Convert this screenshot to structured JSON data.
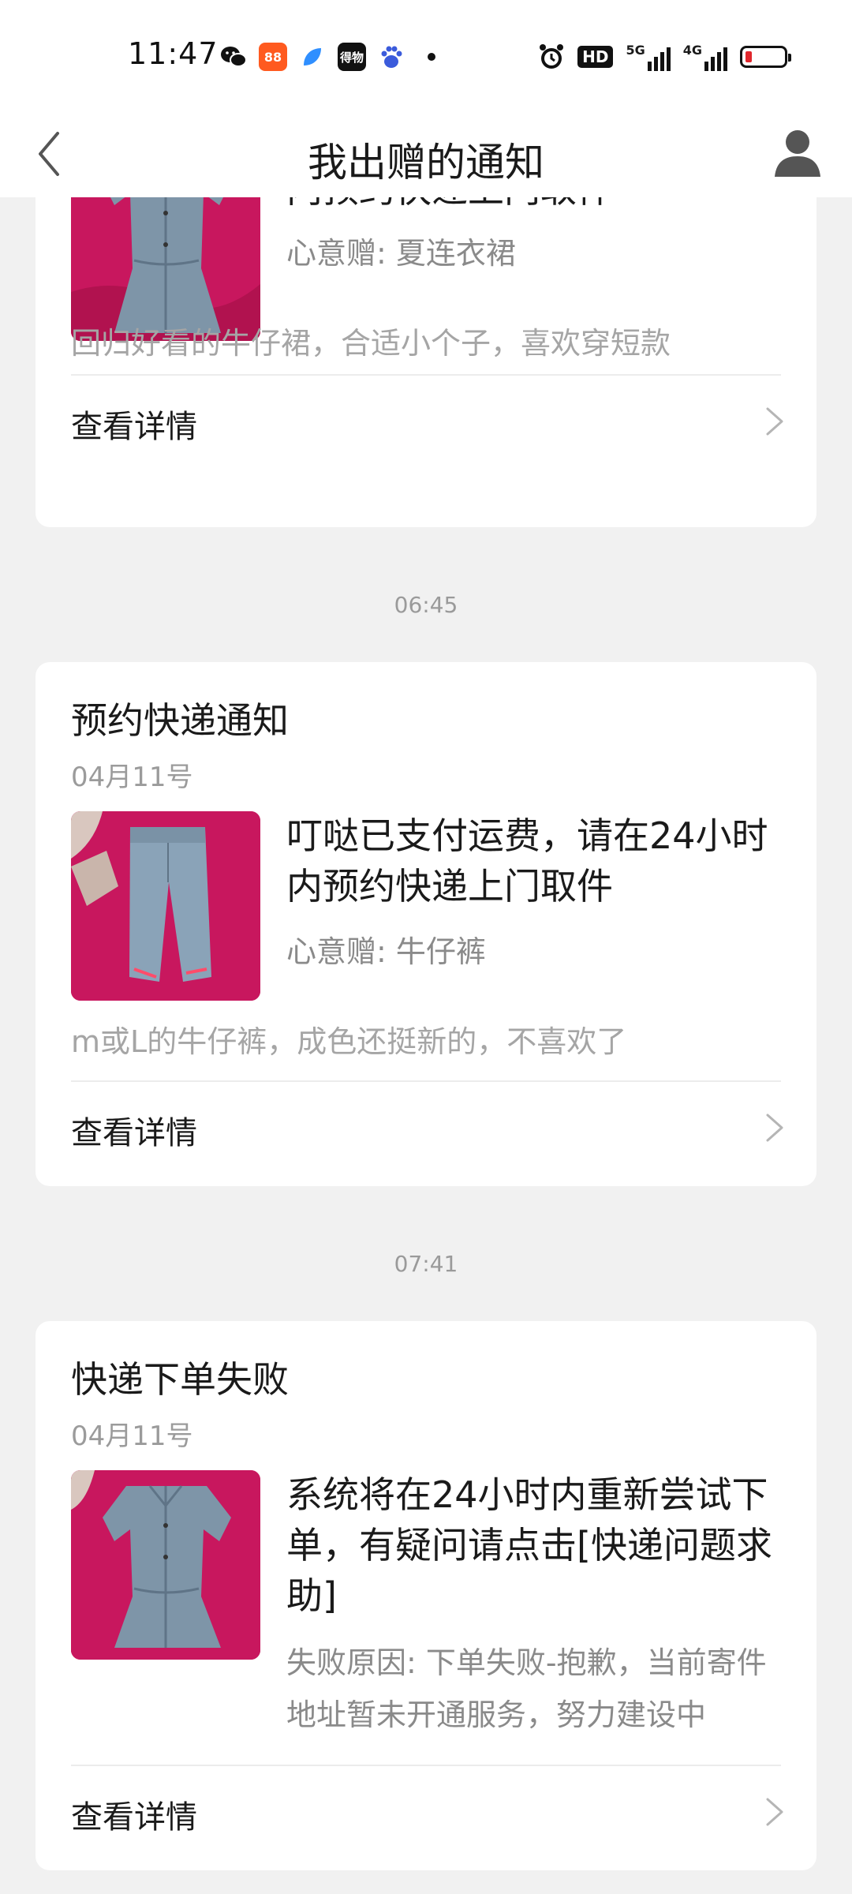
{
  "status_bar": {
    "time": "11:47",
    "app_icons": [
      {
        "name": "wechat-icon",
        "label": ""
      },
      {
        "name": "app-red-icon",
        "label": "88"
      },
      {
        "name": "app-blue-icon",
        "label": ""
      },
      {
        "name": "app-black-icon",
        "label": "得物"
      },
      {
        "name": "baidu-icon",
        "label": ""
      }
    ],
    "hd_label": "HD",
    "net_5g": "5G",
    "net_4g": "4G"
  },
  "header": {
    "title": "我出赠的通知"
  },
  "cards": [
    {
      "message": "内预约快递上门取件",
      "item": "心意赠: 夏连衣裙",
      "description": "回归好看的牛仔裙，合适小个子，喜欢穿短款",
      "details_label": "查看详情"
    },
    {
      "time": "06:45",
      "title": "预约快递通知",
      "date": "04月11号",
      "message": "叮哒已支付运费，请在24小时内预约快递上门取件",
      "item": "心意赠: 牛仔裤",
      "description": "m或L的牛仔裤，成色还挺新的，不喜欢了",
      "details_label": "查看详情"
    },
    {
      "time": "07:41",
      "title": "快递下单失败",
      "date": "04月11号",
      "message": "系统将在24小时内重新尝试下单，有疑问请点击[快递问题求助]",
      "reason": "失败原因: 下单失败-抱歉，当前寄件地址暂未开通服务，努力建设中",
      "details_label": "查看详情"
    }
  ],
  "colors": {
    "background": "#f1f1f1",
    "card": "#ffffff",
    "thumb_background": "#c8175e",
    "primary_text": "#1a1a1a",
    "secondary_text": "#8a8a8a",
    "muted_text": "#a5a5a5"
  }
}
